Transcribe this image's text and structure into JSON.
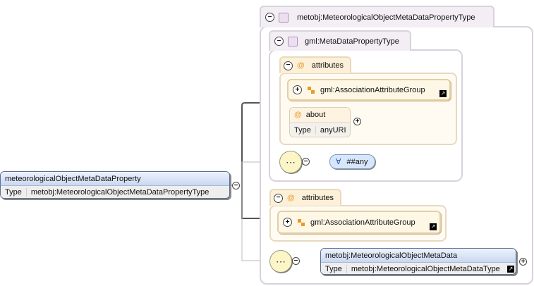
{
  "root_element": {
    "name": "meteorologicalObjectMetaDataProperty",
    "type_label": "Type",
    "type_value": "metobj:MeteorologicalObjectMetaDataPropertyType"
  },
  "outer_complex_type": {
    "label": "metobj:MeteorologicalObjectMetaDataPropertyType"
  },
  "inner_complex_type": {
    "label": "gml:MetaDataPropertyType"
  },
  "inner_attributes": {
    "label": "attributes",
    "group": "gml:AssociationAttributeGroup",
    "about": {
      "name": "about",
      "type_label": "Type",
      "type_value": "anyURI"
    }
  },
  "wildcard": {
    "symbol": "∀",
    "label": "##any"
  },
  "outer_attributes": {
    "label": "attributes",
    "group": "gml:AssociationAttributeGroup"
  },
  "child_element": {
    "name": "metobj:MeteorologicalObjectMetaData",
    "type_label": "Type",
    "type_value": "metobj:MeteorologicalObjectMetaDataType"
  },
  "icons": {
    "collapse": "−",
    "expand": "+",
    "attribute": "@",
    "link": "↗",
    "sequence": "⋯"
  }
}
